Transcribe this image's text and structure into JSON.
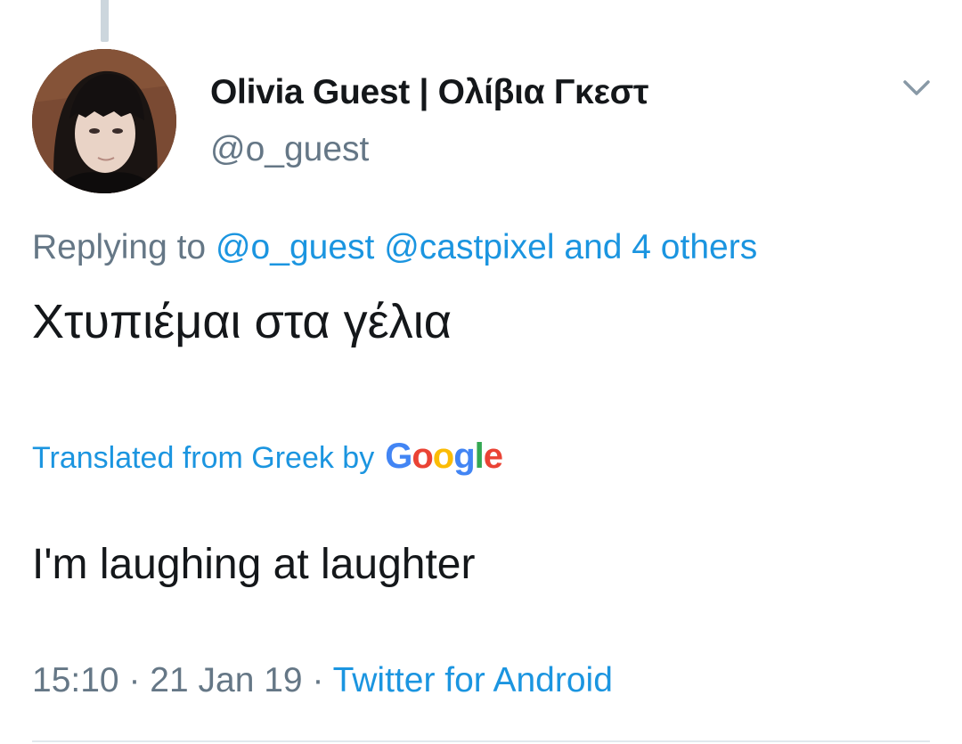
{
  "tweet": {
    "display_name": "Olivia Guest | Ολίβια Γκεστ",
    "handle": "@o_guest",
    "replying_prefix": "Replying to",
    "replying_mention_1": "@o_guest",
    "replying_mention_2": "@castpixel",
    "replying_others": "and 4 others",
    "text": "Χτυπιέμαι στα γέλια",
    "translated_label": "Translated from Greek by",
    "google_letters": [
      "G",
      "o",
      "o",
      "g",
      "l",
      "e"
    ],
    "google_colors": [
      "#4285f4",
      "#ea4335",
      "#fbbc05",
      "#4285f4",
      "#34a853",
      "#ea4335"
    ],
    "translation": "I'm laughing at laughter",
    "time": "15:10",
    "separator": "·",
    "date": "21 Jan 19",
    "source": "Twitter for Android"
  },
  "colors": {
    "text_primary": "#14171a",
    "text_secondary": "#657786",
    "link": "#1b95e0",
    "thread_line": "#ccd6dd",
    "divider": "#e1e8ed"
  },
  "icons": {
    "caret": "chevron-down-icon",
    "avatar": "profile-photo"
  }
}
